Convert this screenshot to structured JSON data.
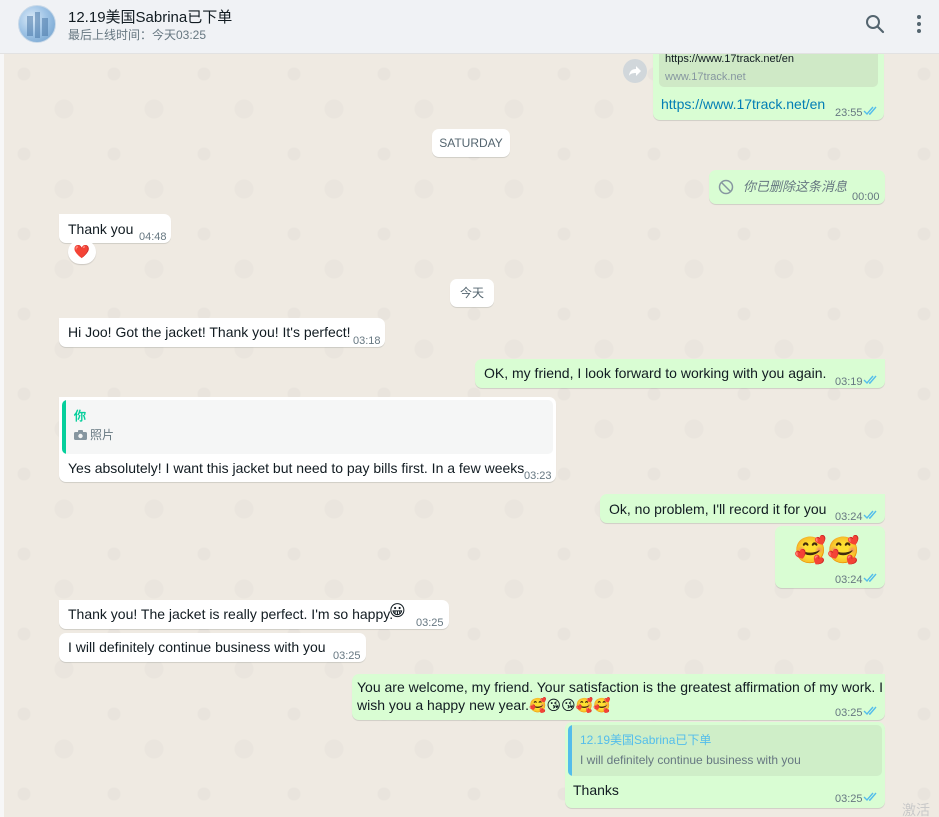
{
  "header": {
    "title": "12.19美国Sabrina已下单",
    "status": "最后上线时间：今天03:25",
    "icons": [
      "search-icon",
      "menu-icon"
    ]
  },
  "messages": {
    "link_preview": {
      "url_top": "https://www.17track.net/en",
      "domain": "www.17track.net",
      "link": "https://www.17track.net/en",
      "time": "23:55"
    },
    "date_saturday": "SATURDAY",
    "deleted": {
      "text": "你已删除这条消息",
      "time": "00:00"
    },
    "thank_you": {
      "text": "Thank you",
      "time": "04:48",
      "reaction": "❤️"
    },
    "date_today": "今天",
    "m1": {
      "text": "Hi Joo! Got the jacket! Thank you! It's perfect!",
      "time": "03:18"
    },
    "m2": {
      "text": "OK, my friend, I look forward to working with you again.",
      "time": "03:19"
    },
    "m3": {
      "quote_author": "你",
      "quote_text": "照片",
      "text": "Yes absolutely! I want this jacket but need to pay bills first. In a few weeks",
      "time": "03:23"
    },
    "m4": {
      "text": "Ok, no problem, I'll record it for you",
      "time": "03:24"
    },
    "m5": {
      "emojis": "🥰🥰",
      "time": "03:24"
    },
    "m6": {
      "text": "Thank you! The jacket is really perfect. I'm so happy.",
      "emoji": "😀",
      "time": "03:25"
    },
    "m7": {
      "text": "I will definitely continue business with you",
      "time": "03:25"
    },
    "m8": {
      "line1": "You are welcome, my friend. Your satisfaction is the greatest affirmation of my work. I",
      "line2": "wish you a happy new year.",
      "emojis": "🥰😘😘🥰🥰",
      "time": "03:25"
    },
    "m9": {
      "quote_author": "12.19美国Sabrina已下单",
      "quote_text": "I will definitely continue business with you",
      "text": "Thanks",
      "time": "03:25"
    }
  },
  "colors": {
    "outgoing": "#d9fdd3",
    "incoming": "#ffffff",
    "chat_bg": "#efeae2",
    "read_tick": "#53bdeb",
    "link": "#027eb5",
    "quote_accent": "#06cf9c",
    "quote_accent_blue": "#53bdeb"
  },
  "corner_watermark": "激活"
}
